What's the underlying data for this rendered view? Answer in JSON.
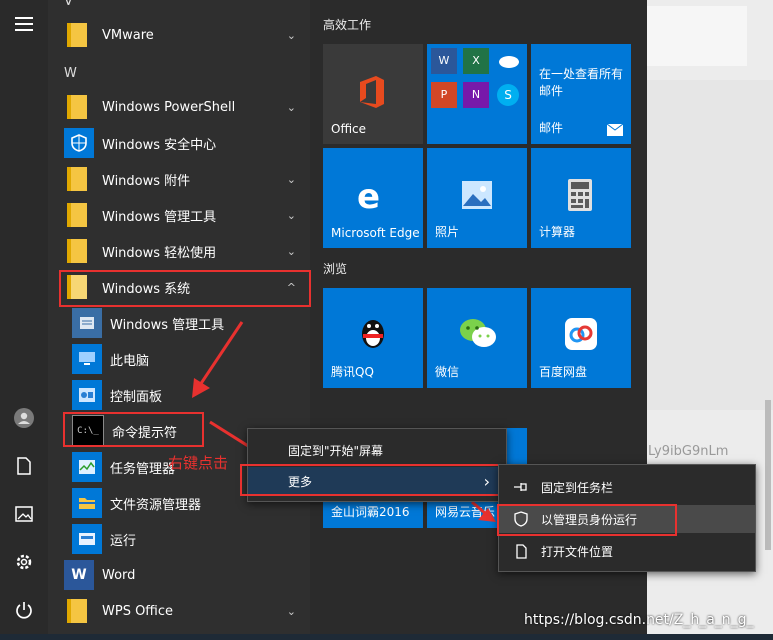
{
  "rail": {
    "icons": [
      "hamburger-menu-icon",
      "user-icon",
      "document-icon",
      "pictures-icon",
      "settings-icon",
      "power-icon"
    ]
  },
  "applist": {
    "letter_v": "V",
    "letter_w": "W",
    "items": [
      {
        "label": "VMware",
        "icon": "folder-icon",
        "chevron": "⌄"
      },
      {
        "label": "Windows PowerShell",
        "icon": "folder-icon",
        "chevron": "⌄"
      },
      {
        "label": "Windows 安全中心",
        "icon": "shield-icon",
        "chevron": ""
      },
      {
        "label": "Windows 附件",
        "icon": "folder-icon",
        "chevron": "⌄"
      },
      {
        "label": "Windows 管理工具",
        "icon": "folder-icon",
        "chevron": "⌄"
      },
      {
        "label": "Windows 轻松使用",
        "icon": "folder-icon",
        "chevron": "⌄"
      },
      {
        "label": "Windows 系统",
        "icon": "folder-icon",
        "chevron": "^"
      }
    ],
    "sub_items": [
      {
        "label": "Windows 管理工具"
      },
      {
        "label": "此电脑"
      },
      {
        "label": "控制面板"
      },
      {
        "label": "命令提示符"
      },
      {
        "label": "任务管理器"
      },
      {
        "label": "文件资源管理器"
      },
      {
        "label": "运行"
      }
    ],
    "after_items": [
      {
        "label": "Word",
        "chevron": ""
      },
      {
        "label": "WPS Office",
        "chevron": "⌄"
      }
    ]
  },
  "tiles": {
    "group1_title": "高效工作",
    "group2_title": "浏览",
    "office": "Office",
    "mail_title": "在一处查看所有邮件",
    "mail": "邮件",
    "edge": "Microsoft Edge",
    "photos": "照片",
    "calculator": "计算器",
    "qq": "腾讯QQ",
    "wechat": "微信",
    "baidu": "百度网盘",
    "jinshan": "金山词霸2016",
    "netease": "网易云音乐"
  },
  "context_menu1": {
    "pin_start": "固定到\"开始\"屏幕",
    "more": "更多",
    "more_arrow": "›"
  },
  "context_menu2": {
    "pin_taskbar": "固定到任务栏",
    "run_admin": "以管理员身份运行",
    "open_location": "打开文件位置"
  },
  "annotation": {
    "right_click": "右键点击"
  },
  "watermark": {
    "id": "Ly9ibG9nLm",
    "url": "https://blog.csdn.net/Z_h_a_n_g_"
  },
  "colors": {
    "tile_blue": "#0078d7",
    "office_tile": "#3a3a3a",
    "highlight_red": "#e8312f",
    "menu_bg": "#2b2b2b"
  }
}
